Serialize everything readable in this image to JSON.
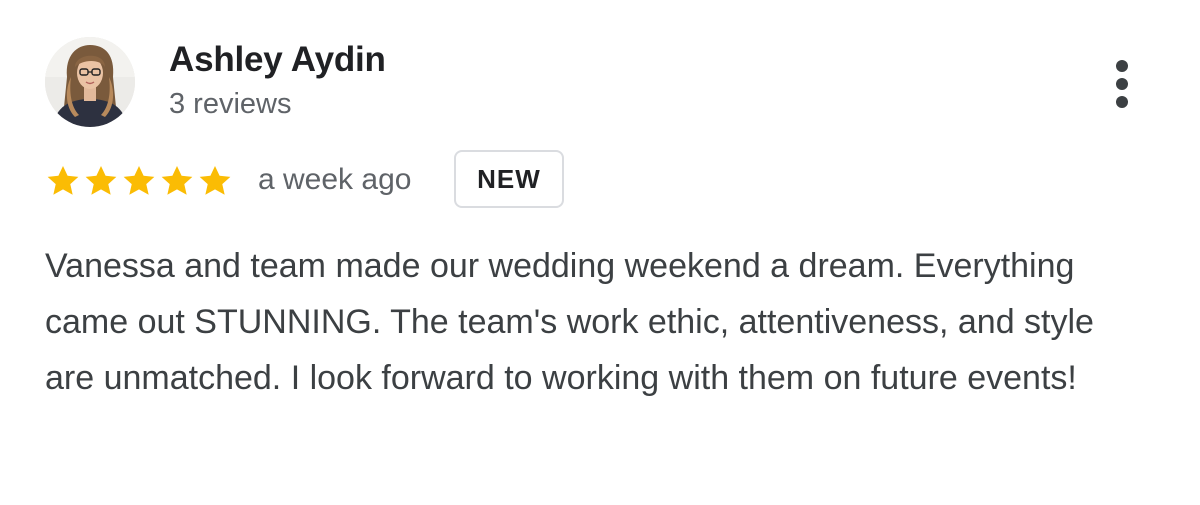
{
  "reviewer": {
    "name": "Ashley Aydin",
    "review_count": "3 reviews",
    "avatar_icon": "person-photo"
  },
  "rating": {
    "stars": 5,
    "max_stars": 5,
    "star_color": "#FBBC04"
  },
  "review": {
    "time": "a week ago",
    "badge": "NEW",
    "text": "Vanessa and team made our wedding weekend a dream. Everything came out STUNNING. The team's work ethic, attentiveness, and style are unmatched. I look forward to working with them on future events!"
  },
  "menu": {
    "icon": "more-vert-icon"
  }
}
